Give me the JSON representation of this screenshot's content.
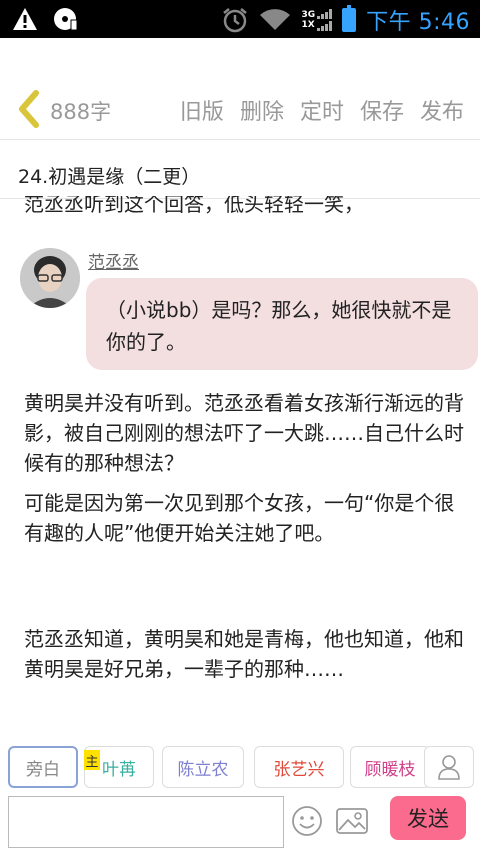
{
  "status_bar": {
    "network_types": [
      "3G",
      "1X"
    ],
    "time": "下午 5:46"
  },
  "toolbar": {
    "word_count": "888字",
    "actions": [
      "旧版",
      "删除",
      "定时",
      "保存",
      "发布"
    ]
  },
  "chapter": {
    "title": "24.初遇是缘（二更）"
  },
  "content": {
    "cut_text": "范丞丞听到这个回答，低头轻轻一笑，",
    "dialogue": {
      "speaker": "范丞丞",
      "text": "（小说bb）是吗？那么，她很快就不是你的了。"
    },
    "paragraphs": [
      "黄明昊并没有听到。范丞丞看着女孩渐行渐远的背影，被自己刚刚的想法吓了一大跳……自己什么时候有的那种想法？",
      "可能是因为第一次见到那个女孩，一句“你是个很有趣的人呢”他便开始关注她了吧。",
      "范丞丞知道，黄明昊和她是青梅，他也知道，他和黄明昊是好兄弟，一辈子的那种……"
    ]
  },
  "roles": {
    "main_tag": "主",
    "items": [
      {
        "label": "旁白",
        "color": "#888888"
      },
      {
        "label": "叶苒",
        "color": "#3ab0a0"
      },
      {
        "label": "陈立农",
        "color": "#7d7fd0"
      },
      {
        "label": "张艺兴",
        "color": "#e04a3a"
      },
      {
        "label": "顾暖枝",
        "color": "#d0418c"
      }
    ]
  },
  "input_bar": {
    "send_label": "发送",
    "input_value": ""
  }
}
